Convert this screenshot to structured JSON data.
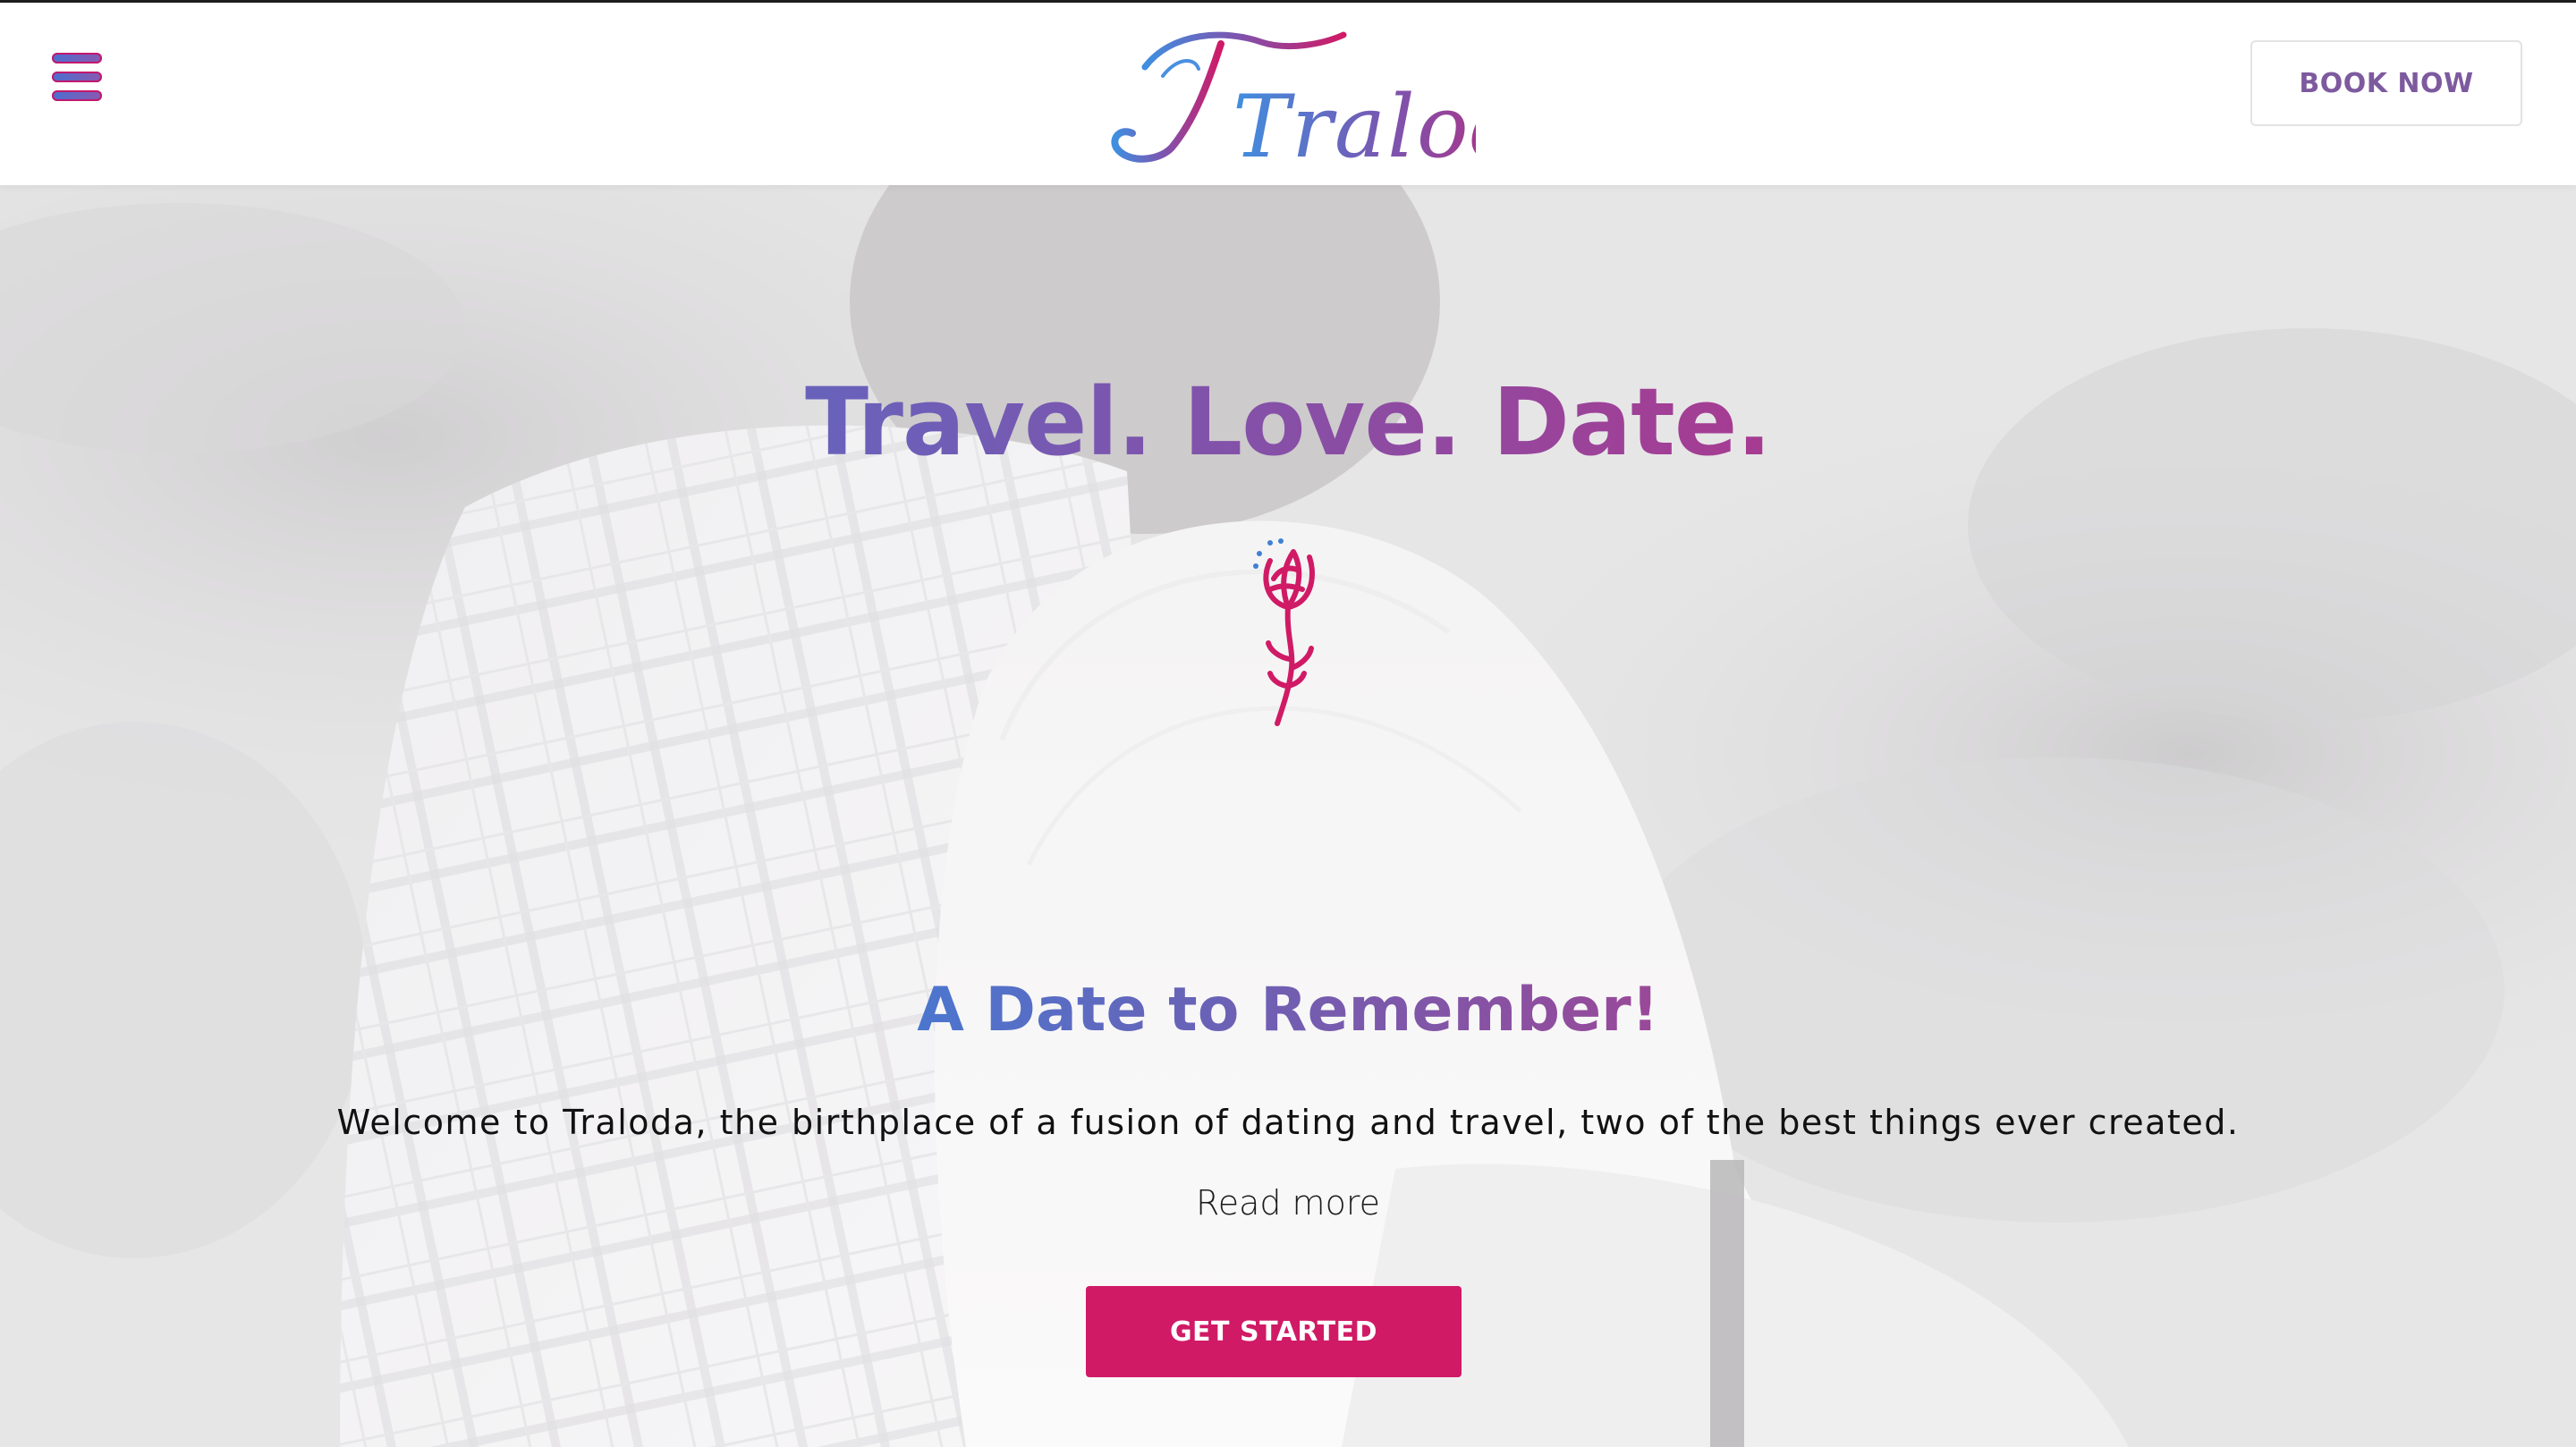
{
  "header": {
    "menu_icon": "hamburger-menu-icon",
    "logo_text": "Traloda",
    "book_label": "BOOK NOW"
  },
  "hero": {
    "headline": [
      "Travel.",
      "Love.",
      "Date."
    ],
    "flower_icon": "flower-icon",
    "subheading": "A Date to Remember!",
    "welcome": "Welcome to Traloda, the birthplace of a fusion of dating and travel, two of the best things ever created.",
    "read_more": "Read more",
    "cta_label": "GET STARTED"
  },
  "colors": {
    "brand_blue": "#3f7fd6",
    "brand_purple": "#7d5a9e",
    "brand_pink": "#d01a66",
    "text_dark": "#111111"
  }
}
